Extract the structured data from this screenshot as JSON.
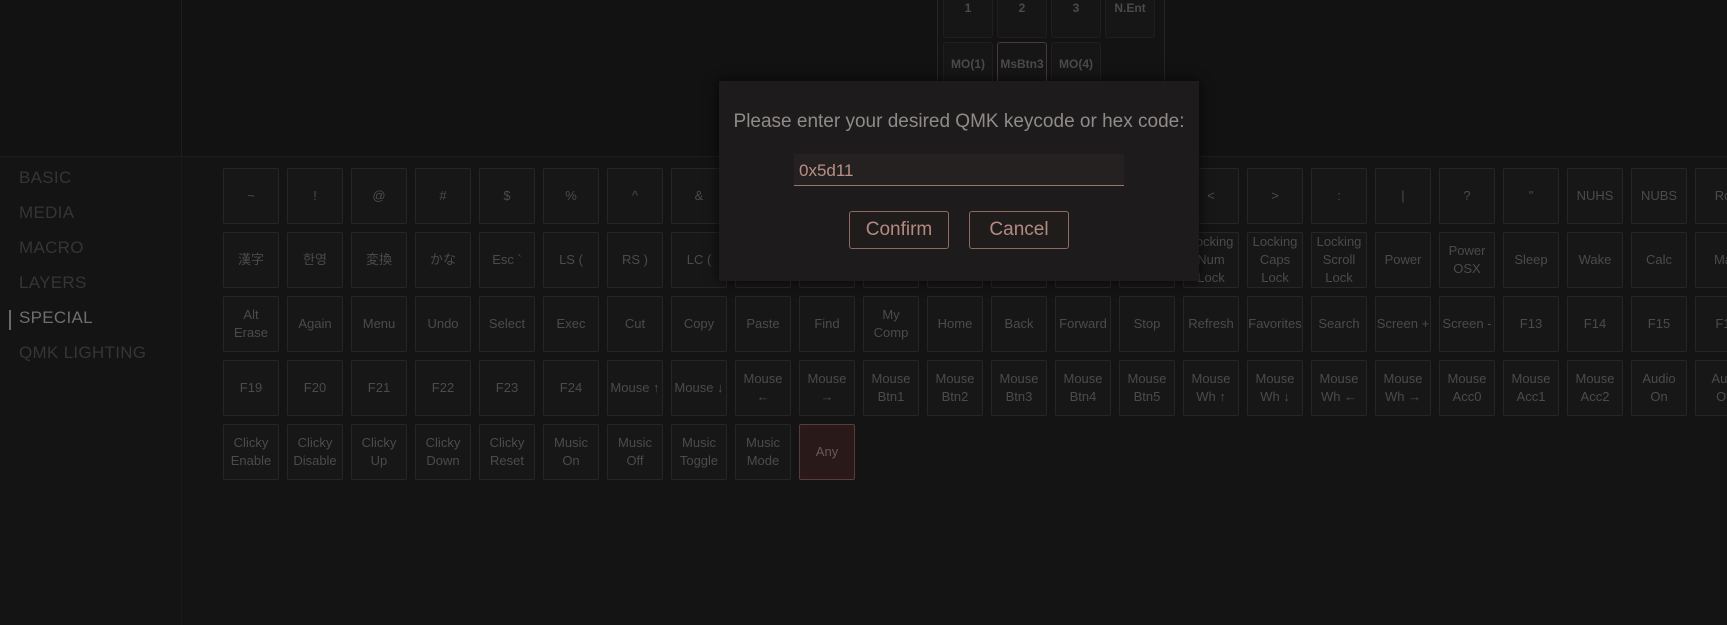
{
  "keymap_preview": {
    "keys": [
      {
        "label": "1",
        "name": "preview-key-1"
      },
      {
        "label": "2",
        "name": "preview-key-2"
      },
      {
        "label": "3",
        "name": "preview-key-3"
      },
      {
        "label": "N.Ent",
        "name": "preview-key-nent"
      },
      {
        "label": "MO(1)",
        "name": "preview-key-mo1"
      },
      {
        "label": "MsBtn3",
        "name": "preview-key-msbtn3"
      },
      {
        "label": "MO(4)",
        "name": "preview-key-mo4"
      }
    ]
  },
  "sidebar": {
    "items": [
      {
        "label": "BASIC",
        "active": false
      },
      {
        "label": "MEDIA",
        "active": false
      },
      {
        "label": "MACRO",
        "active": false
      },
      {
        "label": "LAYERS",
        "active": false
      },
      {
        "label": "SPECIAL",
        "active": true
      },
      {
        "label": "QMK LIGHTING",
        "active": false
      }
    ]
  },
  "keys": {
    "rows": [
      [
        "~",
        "!",
        "@",
        "#",
        "$",
        "%",
        "^",
        "&",
        "",
        "",
        "",
        "",
        "",
        "",
        "",
        "<",
        ">",
        ":",
        "|",
        "?",
        "\"",
        "NUHS",
        "NUBS",
        "Ro"
      ],
      [
        "漢字",
        "한영",
        "変換",
        "かな",
        "Esc `",
        "LS (",
        "RS )",
        "LC (",
        "",
        "",
        "",
        "",
        "",
        "",
        "",
        "Locking\nNum\nLock",
        "Locking\nCaps\nLock",
        "Locking\nScroll\nLock",
        "Power",
        "Power\nOSX",
        "Sleep",
        "Wake",
        "Calc",
        "Ma"
      ],
      [
        "Alt\nErase",
        "Again",
        "Menu",
        "Undo",
        "Select",
        "Exec",
        "Cut",
        "Copy",
        "Paste",
        "Find",
        "My\nComp",
        "Home",
        "Back",
        "Forward",
        "Stop",
        "Refresh",
        "Favorites",
        "Search",
        "Screen +",
        "Screen -",
        "F13",
        "F14",
        "F15",
        "F1"
      ],
      [
        "F19",
        "F20",
        "F21",
        "F22",
        "F23",
        "F24",
        "Mouse ↑",
        "Mouse ↓",
        "Mouse\n←",
        "Mouse\n→",
        "Mouse\nBtn1",
        "Mouse\nBtn2",
        "Mouse\nBtn3",
        "Mouse\nBtn4",
        "Mouse\nBtn5",
        "Mouse\nWh ↑",
        "Mouse\nWh ↓",
        "Mouse\nWh ←",
        "Mouse\nWh →",
        "Mouse\nAcc0",
        "Mouse\nAcc1",
        "Mouse\nAcc2",
        "Audio\nOn",
        "Aud\nOf"
      ],
      [
        "Clicky\nEnable",
        "Clicky\nDisable",
        "Clicky\nUp",
        "Clicky\nDown",
        "Clicky\nReset",
        "Music\nOn",
        "Music\nOff",
        "Music\nToggle",
        "Music\nMode",
        "Any"
      ]
    ]
  },
  "dialog": {
    "prompt": "Please enter your desired QMK keycode or hex code:",
    "input_value": "0x5d11",
    "confirm_label": "Confirm",
    "cancel_label": "Cancel"
  },
  "colors": {
    "background": "#141414",
    "accent": "#9a7670",
    "any_key_highlight": "#2a1919"
  }
}
